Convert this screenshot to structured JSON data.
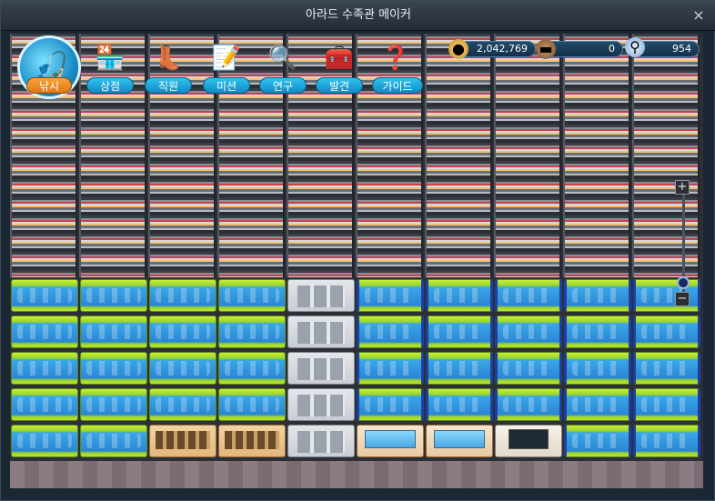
{
  "window": {
    "title": "아라드 수족관 메이커",
    "close_label": "×"
  },
  "menu": [
    {
      "id": "fishing",
      "label": "낚시",
      "icon": "fishing-rod-icon",
      "glyph": "🎣",
      "active": true
    },
    {
      "id": "shop",
      "label": "상점",
      "icon": "shop-stall-icon",
      "glyph": "🏪"
    },
    {
      "id": "staff",
      "label": "직원",
      "icon": "boots-icon",
      "glyph": "👢"
    },
    {
      "id": "mission",
      "label": "미션",
      "icon": "notepad-icon",
      "glyph": "📝"
    },
    {
      "id": "research",
      "label": "연구",
      "icon": "magnifier-book-icon",
      "glyph": "🔍"
    },
    {
      "id": "discovery",
      "label": "발견",
      "icon": "treasure-chest-icon",
      "glyph": "🧰"
    },
    {
      "id": "guide",
      "label": "가이드",
      "icon": "question-box-icon",
      "glyph": "❓"
    }
  ],
  "resources": {
    "gold": {
      "value": "2,042,769",
      "icon": "gold-coin-icon"
    },
    "wood": {
      "value": "0",
      "icon": "wood-log-icon"
    },
    "research": {
      "value": "954",
      "icon": "magnifier-icon"
    }
  },
  "zoom": {
    "plus_label": "+",
    "minus_label": "−"
  },
  "grid": {
    "rows": [
      [
        "tank",
        "tank",
        "tank",
        "tank",
        "elevator",
        "tank",
        "tank",
        "tank",
        "tank",
        "tank"
      ],
      [
        "tank",
        "tank",
        "tank",
        "tank",
        "elevator",
        "tank",
        "tank",
        "tank",
        "tank",
        "tank"
      ],
      [
        "tank",
        "tank",
        "tank",
        "tank",
        "elevator",
        "tank",
        "tank",
        "tank",
        "tank",
        "tank"
      ],
      [
        "tank",
        "tank",
        "tank",
        "tank",
        "elevator",
        "tank",
        "tank",
        "tank",
        "tank",
        "tank"
      ],
      [
        "tank",
        "tank",
        "shop",
        "shop",
        "elevator",
        "lab",
        "lab",
        "office",
        "tank",
        "tank"
      ]
    ]
  }
}
